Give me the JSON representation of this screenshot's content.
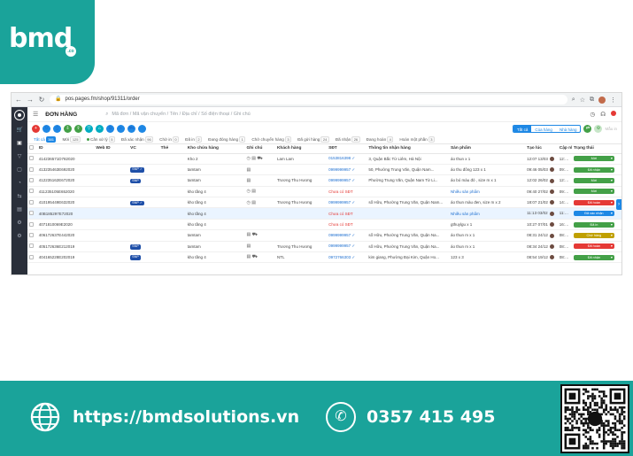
{
  "brand": {
    "logo_text": "bmd",
    "logo_sub": ".co"
  },
  "browser": {
    "url": "pos.pages.fm/shop/91311/order"
  },
  "topbar": {
    "title": "ĐƠN HÀNG",
    "search_placeholder": "Mã đơn / Mã vận chuyển / Tên / Địa chỉ / Số điện thoại / Ghi chú"
  },
  "view_tabs": [
    "Tất cả",
    "Của hàng",
    "Nhà hàng"
  ],
  "toolbar": {
    "extra_label": "Mẫu in"
  },
  "filters": [
    {
      "label": "Tất cả",
      "count": "381",
      "active": true
    },
    {
      "label": "Mới",
      "count": "125"
    },
    {
      "label": "Cần xử lý",
      "count": "5",
      "dot": true
    },
    {
      "label": "Đã xác nhận",
      "count": "96"
    },
    {
      "label": "Chờ in",
      "count": "0"
    },
    {
      "label": "Đã in",
      "count": "2"
    },
    {
      "label": "Đang đóng hàng",
      "count": "1"
    },
    {
      "label": "Chờ chuyển hàng",
      "count": "3"
    },
    {
      "label": "Đã gửi hàng",
      "count": "24"
    },
    {
      "label": "Đã nhận",
      "count": "26"
    },
    {
      "label": "Đang hoàn",
      "count": "4"
    },
    {
      "label": "Hoàn một phần",
      "count": "3"
    }
  ],
  "columns": [
    "ID",
    "Web ID",
    "VC",
    "Thẻ",
    "Kho chứa hàng",
    "Ghi chú",
    "Khách hàng",
    "SĐT",
    "Thông tin nhận hàng",
    "Sản phẩm",
    "Tạo lúc",
    "Cập nhật",
    "Trạng thái"
  ],
  "rows": [
    {
      "id": "414236571D782020",
      "vc": "",
      "warehouse": "Kho 2",
      "note": "◷ ▤ ⛟",
      "customer": "Lam Lam",
      "phone": "0153816398 ✓",
      "address": "3, Quận Bắc Từ Liêm, Hà Nội",
      "product": "áo thun x 1",
      "created": "12:07 13/03",
      "updated": "12:07 1",
      "status": "Mới",
      "status_color": "#43a047",
      "style": ""
    },
    {
      "id": "413235463E692020",
      "vc": "SNP ✓",
      "warehouse": "tamtam",
      "note": "▤",
      "customer": "",
      "phone": "0999999957 ✓",
      "address": "50, Phường Trung Văn, Quận Nam...",
      "product": "áo thu đông 123 x 1",
      "created": "09:46 05/03",
      "updated": "09:50 0",
      "status": "Đã nhận",
      "status_color": "#43a047",
      "style": ""
    },
    {
      "id": "412235162E672020",
      "vc": "SNP",
      "warehouse": "tamtam",
      "note": "▤",
      "customer": "Trương Thu Hương",
      "phone": "0999999957 ✓",
      "address": "Phường Trung Văn, Quận Nam Từ Li...",
      "product": "áo bó màu đỏ , size m x 1",
      "created": "12:02 26/02",
      "updated": "12:02 2",
      "status": "Mới",
      "status_color": "#43a047",
      "style": ""
    },
    {
      "id": "411235105E652020",
      "vc": "",
      "warehouse": "kho tầng 4",
      "note": "◷ ▤",
      "customer": "",
      "phone": "Chưa có SĐT",
      "address": "",
      "product": "Nhiều sản phẩm",
      "created": "09:40 27/02",
      "updated": "09:40 2",
      "status": "Mới",
      "status_color": "#43a047",
      "style": ""
    },
    {
      "id": "410195449E632020",
      "vc": "SNP ✓",
      "warehouse": "kho tầng 4",
      "note": "◷ ▤",
      "customer": "Trương Thu Hương",
      "phone": "0999999957 ✓",
      "address": "số Hữu, Phường Trung Văn, Quận Nam...",
      "product": "áo thun màu đen, size m x 2",
      "created": "18:07 21/02",
      "updated": "14:23 2",
      "status": "Đã hoàn",
      "status_color": "#e53935",
      "style": ""
    },
    {
      "id": "40B185297E72020",
      "vc": "",
      "warehouse": "kho tầng 4",
      "note": "",
      "customer": "",
      "phone": "Chưa có SĐT",
      "address": "",
      "product": "Nhiều sản phẩm",
      "created": "11:13 03/02",
      "updated": "11:17 0",
      "status": "Đã xác nhận",
      "status_color": "#1e88e5",
      "style": "hl"
    },
    {
      "id": "4071810069E2020",
      "vc": "",
      "warehouse": "kho tầng 4",
      "note": "",
      "customer": "",
      "phone": "Chưa có SĐT",
      "address": "",
      "product": "gthuylgu x 1",
      "created": "10:27 07/01",
      "updated": "16:41 1",
      "status": "Đã in",
      "status_color": "#43a047",
      "style": ""
    },
    {
      "id": "406172637E442020",
      "vc": "",
      "warehouse": "tamtam",
      "note": "▤ ⛟",
      "customer": "",
      "phone": "0999999957 ✓",
      "address": "số Hữu, Phường Trung Văn, Quận Na...",
      "product": "áo thun m x 1",
      "created": "08:31 24/12",
      "updated": "08:31 2",
      "status": "Chờ hàng",
      "status_color": "#c0a000",
      "style": ""
    },
    {
      "id": "405172636E212019",
      "vc": "SNP",
      "warehouse": "tamtam",
      "note": "▤",
      "customer": "Trương Thu Hương",
      "phone": "0999999957 ✓",
      "address": "số Hữu, Phường Trung Văn, Quận Na...",
      "product": "áo thun m x 1",
      "created": "08:34 24/12",
      "updated": "08:34 2",
      "status": "Đã hoàn",
      "status_color": "#e53935",
      "style": ""
    },
    {
      "id": "404165228E202019",
      "vc": "SNP",
      "warehouse": "kho tầng 4",
      "note": "▤ ⛟",
      "customer": "NTL",
      "phone": "0972766303 ✓",
      "address": "kim giang, Phường Đại Kim, Quận Ho...",
      "product": "123 x 3",
      "created": "08:54 19/12",
      "updated": "08:54 1",
      "status": "Đã nhận",
      "status_color": "#43a047",
      "style": ""
    }
  ],
  "footer": {
    "website": "https://bmdsolutions.vn",
    "phone": "0357 415 495"
  }
}
